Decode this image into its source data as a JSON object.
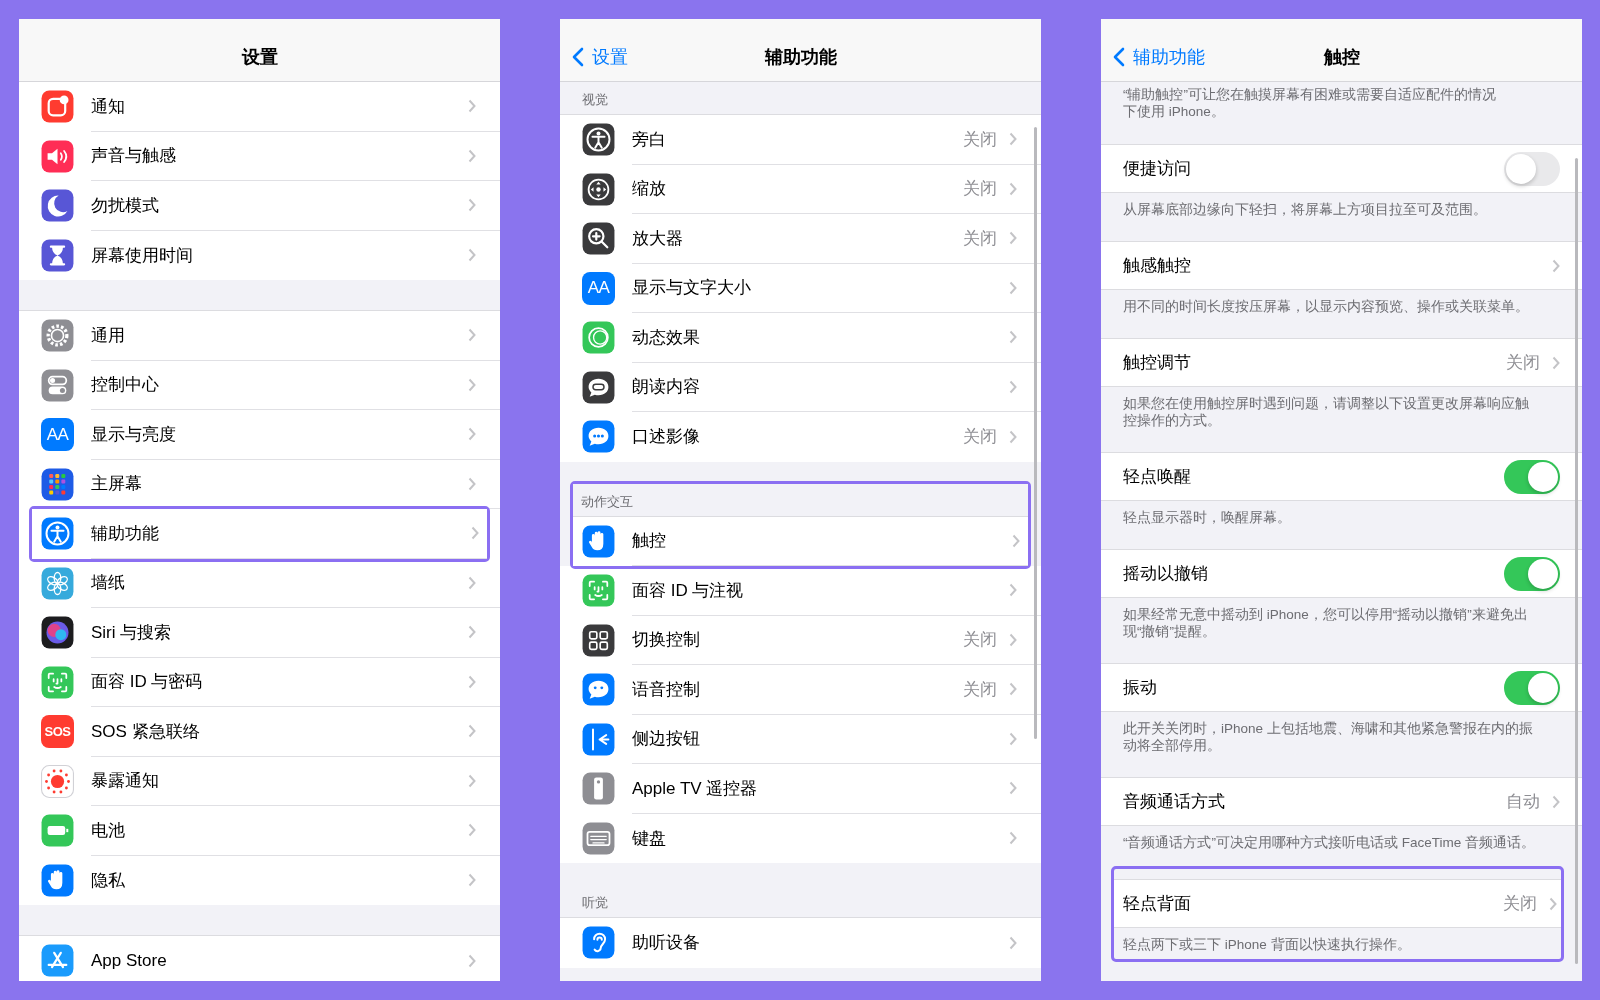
{
  "settings": {
    "title": "设置",
    "groups": [
      {
        "items": [
          {
            "label": "通知",
            "highlighted": false
          },
          {
            "label": "声音与触感",
            "highlighted": false
          },
          {
            "label": "勿扰模式",
            "highlighted": false
          },
          {
            "label": "屏幕使用时间",
            "highlighted": false
          }
        ]
      },
      {
        "items": [
          {
            "label": "通用",
            "highlighted": false
          },
          {
            "label": "控制中心",
            "highlighted": false
          },
          {
            "label": "显示与亮度",
            "icon_text": "AA",
            "highlighted": false
          },
          {
            "label": "主屏幕",
            "highlighted": false
          },
          {
            "label": "辅助功能",
            "highlighted": true
          },
          {
            "label": "墙纸",
            "highlighted": false
          },
          {
            "label": "Siri 与搜索",
            "highlighted": false
          },
          {
            "label": "面容 ID 与密码",
            "highlighted": false
          },
          {
            "label": "SOS 紧急联络",
            "icon_text": "SOS",
            "highlighted": false
          },
          {
            "label": "暴露通知",
            "highlighted": false
          },
          {
            "label": "电池",
            "highlighted": false
          },
          {
            "label": "隐私",
            "highlighted": false
          }
        ]
      },
      {
        "items": [
          {
            "label": "App Store",
            "highlighted": false
          }
        ]
      }
    ]
  },
  "accessibility": {
    "back": "设置",
    "title": "辅助功能",
    "sections": [
      {
        "header": "视觉",
        "items": [
          {
            "label": "旁白",
            "value": "关闭",
            "highlighted": false
          },
          {
            "label": "缩放",
            "value": "关闭",
            "highlighted": false
          },
          {
            "label": "放大器",
            "value": "关闭",
            "highlighted": false
          },
          {
            "label": "显示与文字大小",
            "icon_text": "AA",
            "highlighted": false
          },
          {
            "label": "动态效果",
            "highlighted": false
          },
          {
            "label": "朗读内容",
            "highlighted": false
          },
          {
            "label": "口述影像",
            "value": "关闭",
            "highlighted": false
          }
        ]
      },
      {
        "header": "动作交互",
        "items": [
          {
            "label": "触控",
            "highlighted": true
          },
          {
            "label": "面容 ID 与注视",
            "highlighted": false
          },
          {
            "label": "切换控制",
            "value": "关闭",
            "highlighted": false
          },
          {
            "label": "语音控制",
            "value": "关闭",
            "highlighted": false
          },
          {
            "label": "侧边按钮",
            "highlighted": false
          },
          {
            "label": "Apple TV 遥控器",
            "highlighted": false
          },
          {
            "label": "键盘",
            "highlighted": false
          }
        ]
      },
      {
        "header": "听觉",
        "items": [
          {
            "label": "助听设备",
            "highlighted": false
          }
        ]
      }
    ]
  },
  "touch": {
    "back": "辅助功能",
    "title": "触控",
    "intro": "“辅助触控”可让您在触摸屏幕有困难或需要自适应配件的情况下使用 iPhone。",
    "groups": [
      {
        "kind": "toggle",
        "label": "便捷访问",
        "on": false,
        "footer": "从屏幕底部边缘向下轻扫，将屏幕上方项目拉至可及范围。",
        "highlighted": false
      },
      {
        "kind": "link",
        "label": "触感触控",
        "footer": "用不同的时间长度按压屏幕，以显示内容预览、操作或关联菜单。",
        "highlighted": false
      },
      {
        "kind": "link",
        "label": "触控调节",
        "value": "关闭",
        "footer": "如果您在使用触控屏时遇到问题，请调整以下设置更改屏幕响应触控操作的方式。",
        "highlighted": false
      },
      {
        "kind": "toggle",
        "label": "轻点唤醒",
        "on": true,
        "footer": "轻点显示器时，唤醒屏幕。",
        "highlighted": false
      },
      {
        "kind": "toggle",
        "label": "摇动以撤销",
        "on": true,
        "footer": "如果经常无意中摇动到 iPhone，您可以停用“摇动以撤销”来避免出现“撤销”提醒。",
        "highlighted": false
      },
      {
        "kind": "toggle",
        "label": "振动",
        "on": true,
        "footer": "此开关关闭时，iPhone 上包括地震、海啸和其他紧急警报在内的振动将全部停用。",
        "highlighted": false
      },
      {
        "kind": "link",
        "label": "音频通话方式",
        "value": "自动",
        "footer": "“音频通话方式”可决定用哪种方式接听电话或 FaceTime 音频通话。",
        "highlighted": false
      },
      {
        "kind": "link",
        "label": "轻点背面",
        "value": "关闭",
        "footer": "轻点两下或三下 iPhone 背面以快速执行操作。",
        "highlighted": true
      }
    ]
  }
}
